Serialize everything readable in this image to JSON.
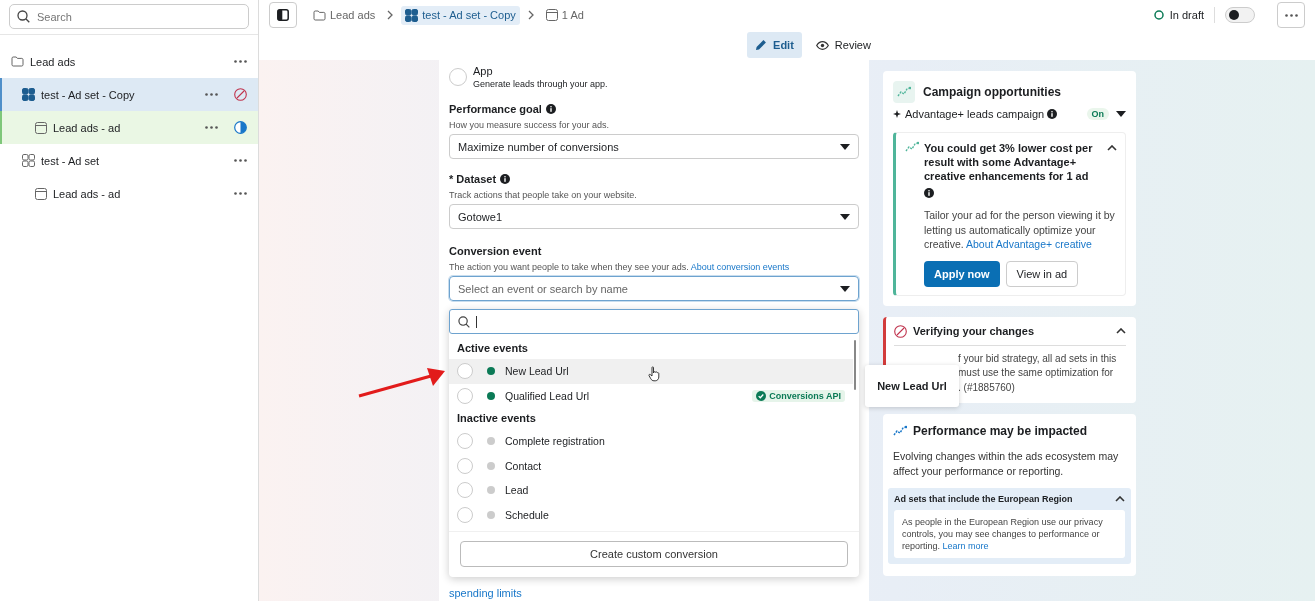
{
  "sidebar": {
    "search": {
      "placeholder": "Search"
    },
    "items": [
      {
        "kind": "campaign",
        "label": "Lead ads",
        "selected": false,
        "editing": false,
        "has_error": false,
        "in_progress": false,
        "children": [
          {
            "kind": "adset",
            "label": "test - Ad set - Copy",
            "selected": true,
            "editing": false,
            "has_error": true,
            "in_progress": false,
            "children": [
              {
                "kind": "ad",
                "label": "Lead ads - ad",
                "selected": false,
                "editing": true,
                "has_error": false,
                "in_progress": true
              }
            ]
          },
          {
            "kind": "adset",
            "label": "test - Ad set",
            "selected": false,
            "editing": false,
            "has_error": false,
            "in_progress": false,
            "children": [
              {
                "kind": "ad",
                "label": "Lead ads - ad",
                "selected": false,
                "editing": false,
                "has_error": false,
                "in_progress": false
              }
            ]
          }
        ]
      }
    ]
  },
  "breadcrumb": [
    {
      "kind": "campaign",
      "label": "Lead ads",
      "selected": false
    },
    {
      "kind": "adset",
      "label": "test - Ad set - Copy",
      "selected": true
    },
    {
      "kind": "ad",
      "label": "1 Ad",
      "selected": false
    }
  ],
  "draft_status": {
    "label": "In draft",
    "toggle_on": false
  },
  "mode_tabs": [
    {
      "kind": "edit",
      "label": "Edit",
      "selected": true
    },
    {
      "kind": "review",
      "label": "Review",
      "selected": false
    }
  ],
  "form": {
    "option": {
      "label": "App",
      "description": "Generate leads through your app.",
      "selected": false
    },
    "fields": [
      {
        "label": "Performance goal",
        "info": true,
        "help": "How you measure success for your ads.",
        "value": "Maximize number of conversions"
      },
      {
        "label": "* Dataset",
        "info": true,
        "help": "Track actions that people take on your website.",
        "value": "Gotowe1"
      }
    ],
    "conversion_event": {
      "label": "Conversion event",
      "help": "The action you want people to take when they see your ads.",
      "help_link": "About conversion events",
      "placeholder": "Select an event or search by name",
      "focused": true
    },
    "footer_link": "spending limits"
  },
  "event_menu": {
    "groups": [
      {
        "title": "Active events",
        "events": [
          {
            "label": "New Lead Url",
            "color": "#0b7a56",
            "selected": false,
            "hovered": true
          },
          {
            "label": "Qualified Lead Url",
            "color": "#0b7a56",
            "selected": false,
            "hovered": false,
            "badge": "Conversions API"
          }
        ]
      },
      {
        "title": "Inactive events",
        "events": [
          {
            "label": "Complete registration",
            "color": "#cccccc",
            "selected": false,
            "hovered": false
          },
          {
            "label": "Contact",
            "color": "#cccccc",
            "selected": false,
            "hovered": false
          },
          {
            "label": "Lead",
            "color": "#cccccc",
            "selected": false,
            "hovered": false
          },
          {
            "label": "Schedule",
            "color": "#cccccc",
            "selected": false,
            "hovered": false
          }
        ]
      }
    ],
    "action": "Create custom conversion"
  },
  "tooltip": "New Lead Url",
  "opportunities": {
    "title": "Campaign opportunities",
    "setting": {
      "label": "Advantage+ leads campaign",
      "badge": "On"
    },
    "recommendation": {
      "title": "You could get 3% lower cost per result with some Advantage+ creative enhancements for 1 ad",
      "body": "Tailor your ad for the person viewing it by letting us automatically optimize your creative.",
      "link": "About Advantage+ creative",
      "expanded": true,
      "buttons": [
        {
          "kind": "primary",
          "label": "Apply now"
        },
        {
          "kind": "secondary",
          "label": "View in ad"
        }
      ]
    }
  },
  "verification": {
    "title": "Verifying your changes",
    "expanded": true,
    "lines": [
      "f your bid strategy, all ad sets in this",
      "must use the same optimization for",
      ". (#1885760)"
    ]
  },
  "performance": {
    "title": "Performance may be impacted",
    "body": "Evolving changes within the ads ecosystem may affect your performance or reporting.",
    "notice": {
      "title": "Ad sets that include the European Region",
      "expanded": true,
      "body": "As people in the European Region use our privacy controls, you may see changes to performance or reporting.",
      "link": "Learn more"
    }
  }
}
